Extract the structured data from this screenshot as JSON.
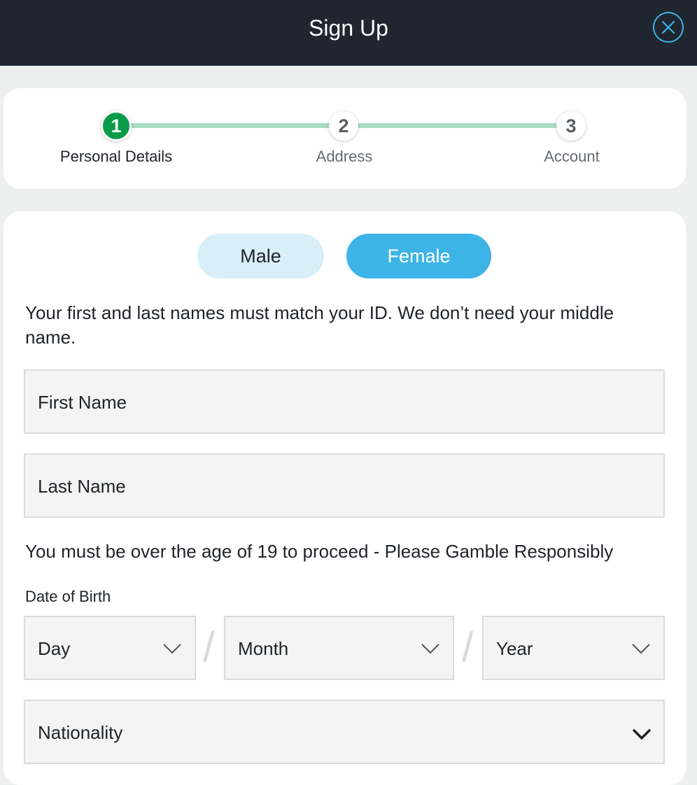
{
  "header": {
    "title": "Sign Up"
  },
  "steps": [
    {
      "number": "1",
      "label": "Personal Details"
    },
    {
      "number": "2",
      "label": "Address"
    },
    {
      "number": "3",
      "label": "Account"
    }
  ],
  "gender": {
    "male": "Male",
    "female": "Female",
    "selected": "Female"
  },
  "name_notice": "Your first and last names must match your ID. We don’t need your middle name.",
  "first_name": {
    "placeholder": "First Name"
  },
  "last_name": {
    "placeholder": "Last Name"
  },
  "age_notice": "You must be over the age of 19 to proceed - Please Gamble Responsibly",
  "dob": {
    "label": "Date of Birth",
    "day": "Day",
    "month": "Month",
    "year": "Year",
    "separator": "/"
  },
  "nationality": {
    "placeholder": "Nationality"
  },
  "colors": {
    "header_bg": "#1f2630",
    "accent": "#3db3e6",
    "step_active": "#0a9b4a",
    "step_line": "#a8dcc0"
  }
}
